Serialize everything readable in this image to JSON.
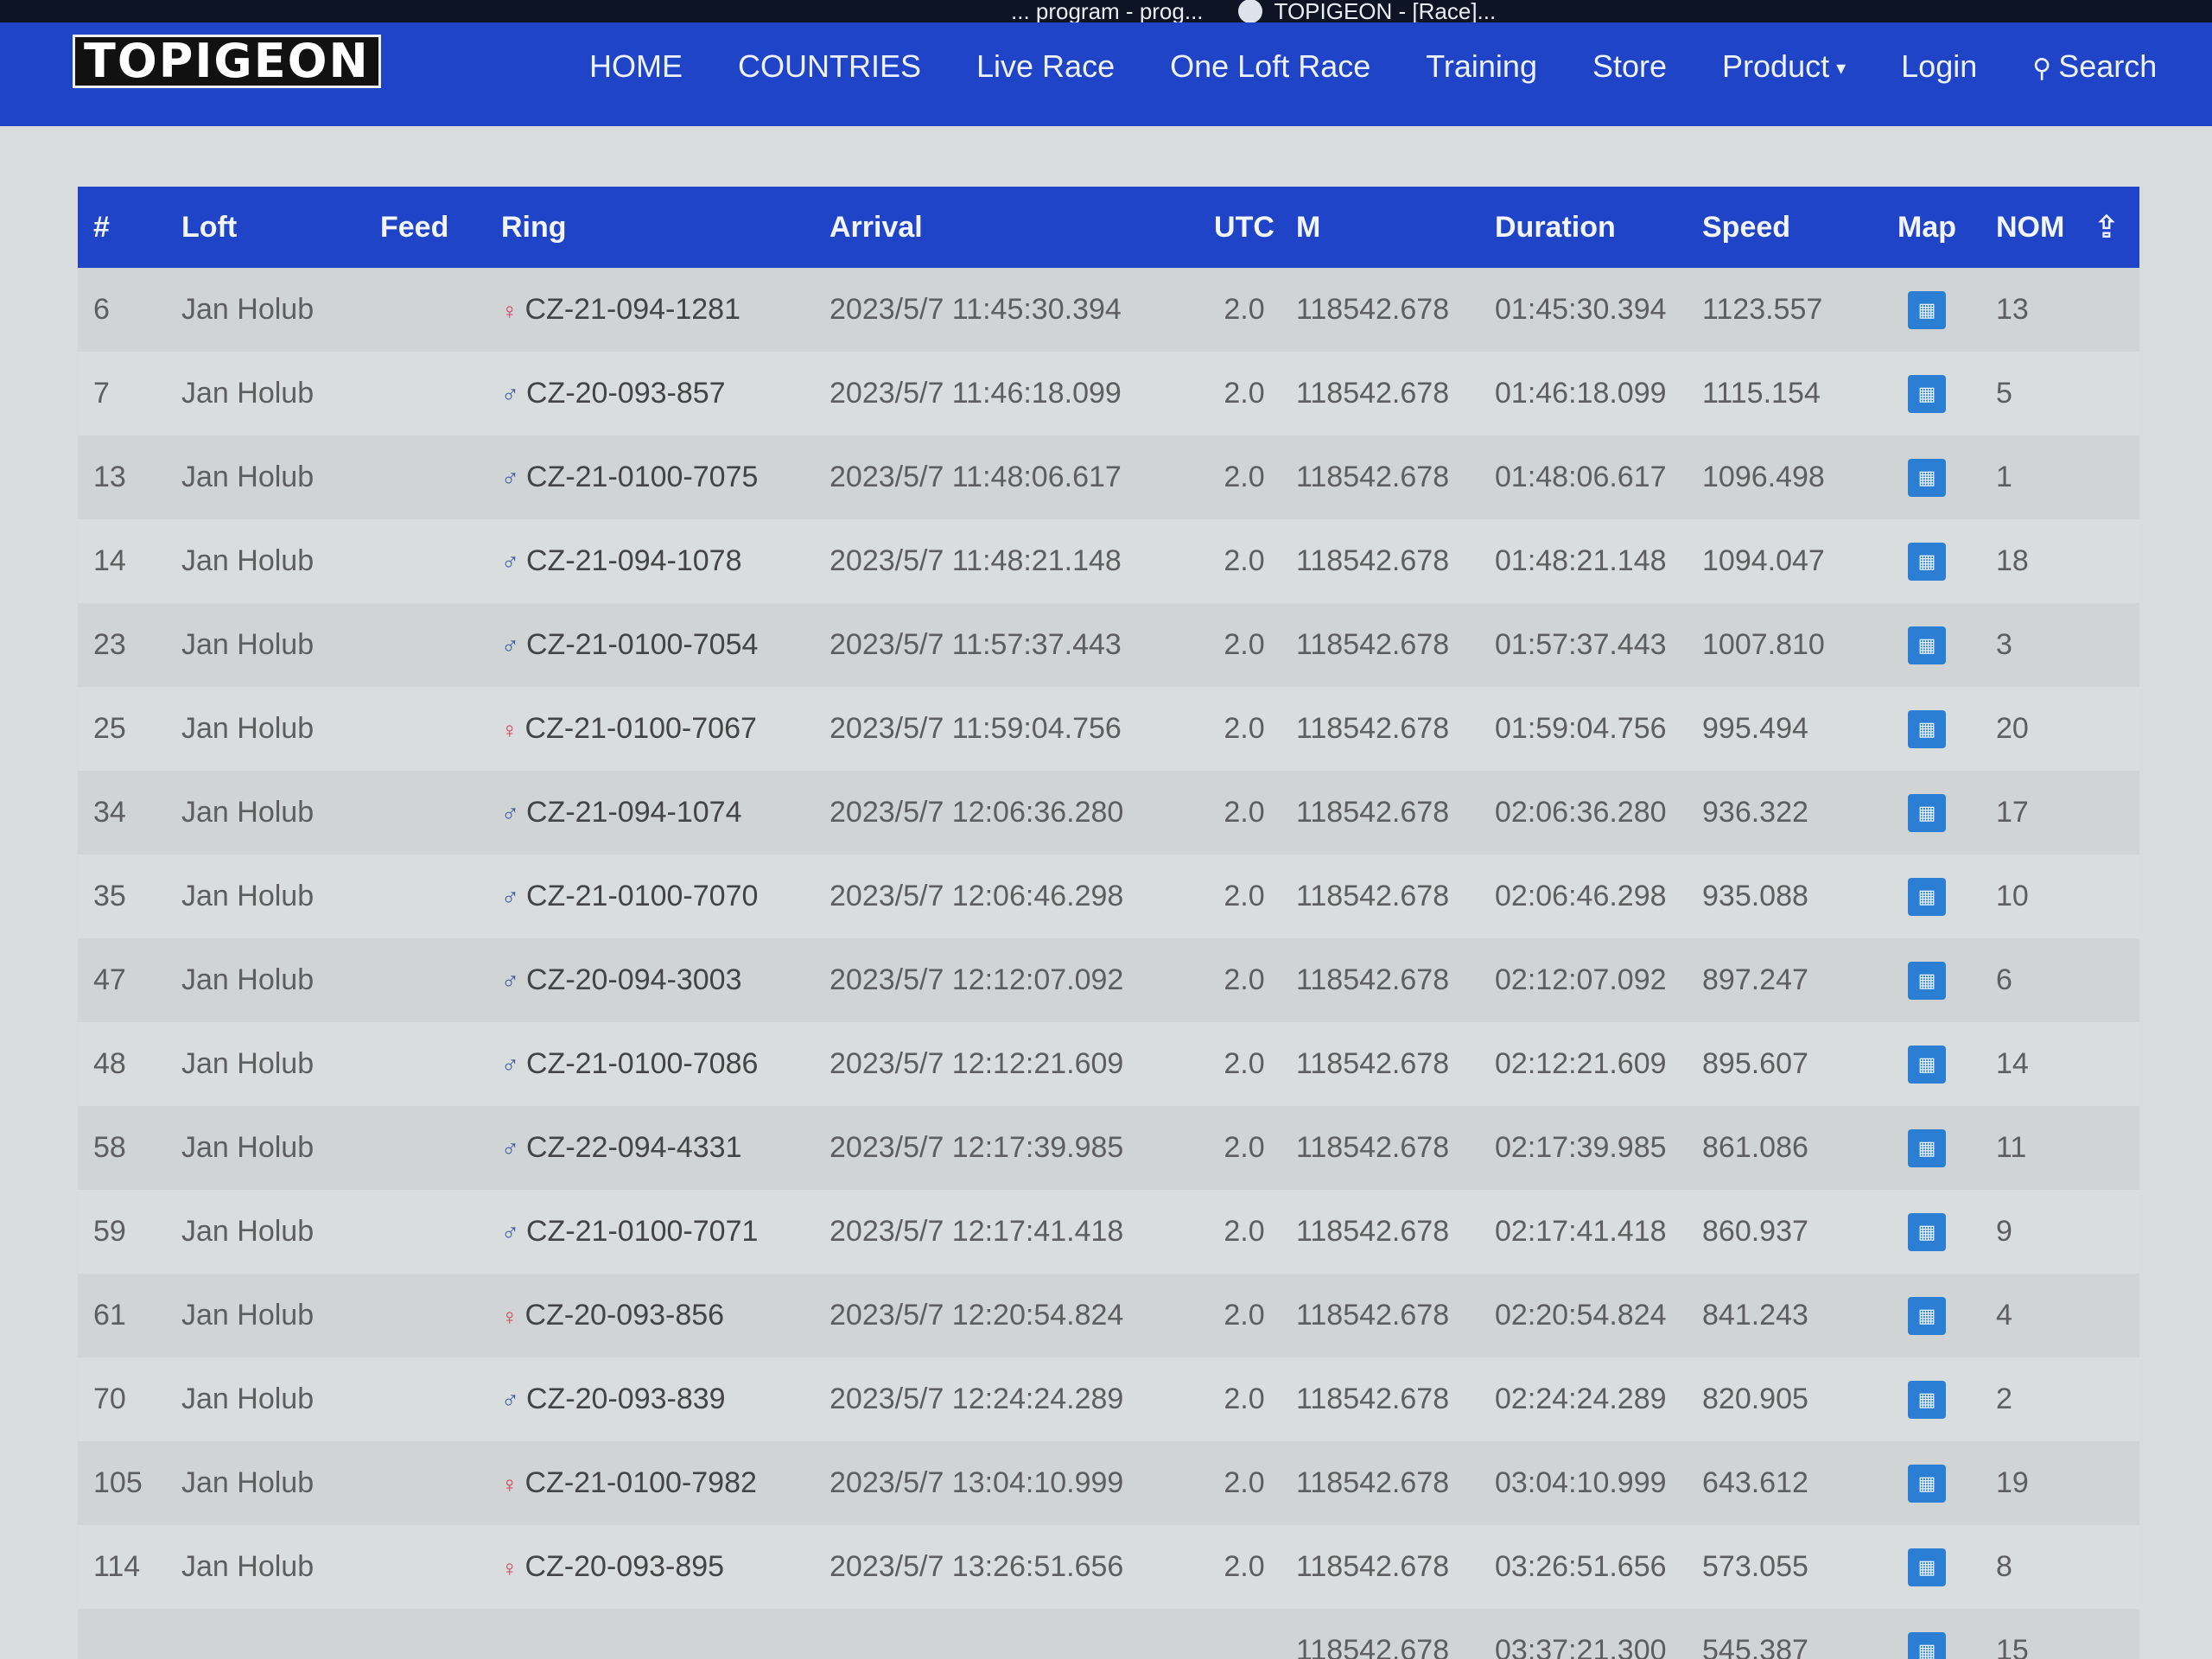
{
  "os_bar": {
    "tab1": "... program - prog...",
    "tab2": "TOPIGEON - [Race]..."
  },
  "brand": {
    "logo_text": "TOPIGEON"
  },
  "nav": {
    "items": [
      {
        "label": "HOME"
      },
      {
        "label": "COUNTRIES"
      },
      {
        "label": "Live Race"
      },
      {
        "label": "One Loft Race"
      },
      {
        "label": "Training"
      },
      {
        "label": "Store"
      },
      {
        "label": "Product"
      },
      {
        "label": "Login"
      },
      {
        "label": "Search"
      }
    ]
  },
  "table": {
    "headers": {
      "num": "#",
      "loft": "Loft",
      "feed": "Feed",
      "ring": "Ring",
      "arrival": "Arrival",
      "utc": "UTC",
      "m": "M",
      "duration": "Duration",
      "speed": "Speed",
      "map": "Map",
      "nom": "NOM"
    },
    "rows": [
      {
        "num": "6",
        "loft": "Jan Holub",
        "feed": "",
        "sex": "♀",
        "ring": "CZ-21-094-1281",
        "arrival": "2023/5/7 11:45:30.394",
        "utc": "2.0",
        "m": "118542.678",
        "duration": "01:45:30.394",
        "speed": "1123.557",
        "nom": "13"
      },
      {
        "num": "7",
        "loft": "Jan Holub",
        "feed": "",
        "sex": "♂",
        "ring": "CZ-20-093-857",
        "arrival": "2023/5/7 11:46:18.099",
        "utc": "2.0",
        "m": "118542.678",
        "duration": "01:46:18.099",
        "speed": "1115.154",
        "nom": "5"
      },
      {
        "num": "13",
        "loft": "Jan Holub",
        "feed": "",
        "sex": "♂",
        "ring": "CZ-21-0100-7075",
        "arrival": "2023/5/7 11:48:06.617",
        "utc": "2.0",
        "m": "118542.678",
        "duration": "01:48:06.617",
        "speed": "1096.498",
        "nom": "1"
      },
      {
        "num": "14",
        "loft": "Jan Holub",
        "feed": "",
        "sex": "♂",
        "ring": "CZ-21-094-1078",
        "arrival": "2023/5/7 11:48:21.148",
        "utc": "2.0",
        "m": "118542.678",
        "duration": "01:48:21.148",
        "speed": "1094.047",
        "nom": "18"
      },
      {
        "num": "23",
        "loft": "Jan Holub",
        "feed": "",
        "sex": "♂",
        "ring": "CZ-21-0100-7054",
        "arrival": "2023/5/7 11:57:37.443",
        "utc": "2.0",
        "m": "118542.678",
        "duration": "01:57:37.443",
        "speed": "1007.810",
        "nom": "3"
      },
      {
        "num": "25",
        "loft": "Jan Holub",
        "feed": "",
        "sex": "♀",
        "ring": "CZ-21-0100-7067",
        "arrival": "2023/5/7 11:59:04.756",
        "utc": "2.0",
        "m": "118542.678",
        "duration": "01:59:04.756",
        "speed": "995.494",
        "nom": "20"
      },
      {
        "num": "34",
        "loft": "Jan Holub",
        "feed": "",
        "sex": "♂",
        "ring": "CZ-21-094-1074",
        "arrival": "2023/5/7 12:06:36.280",
        "utc": "2.0",
        "m": "118542.678",
        "duration": "02:06:36.280",
        "speed": "936.322",
        "nom": "17"
      },
      {
        "num": "35",
        "loft": "Jan Holub",
        "feed": "",
        "sex": "♂",
        "ring": "CZ-21-0100-7070",
        "arrival": "2023/5/7 12:06:46.298",
        "utc": "2.0",
        "m": "118542.678",
        "duration": "02:06:46.298",
        "speed": "935.088",
        "nom": "10"
      },
      {
        "num": "47",
        "loft": "Jan Holub",
        "feed": "",
        "sex": "♂",
        "ring": "CZ-20-094-3003",
        "arrival": "2023/5/7 12:12:07.092",
        "utc": "2.0",
        "m": "118542.678",
        "duration": "02:12:07.092",
        "speed": "897.247",
        "nom": "6"
      },
      {
        "num": "48",
        "loft": "Jan Holub",
        "feed": "",
        "sex": "♂",
        "ring": "CZ-21-0100-7086",
        "arrival": "2023/5/7 12:12:21.609",
        "utc": "2.0",
        "m": "118542.678",
        "duration": "02:12:21.609",
        "speed": "895.607",
        "nom": "14"
      },
      {
        "num": "58",
        "loft": "Jan Holub",
        "feed": "",
        "sex": "♂",
        "ring": "CZ-22-094-4331",
        "arrival": "2023/5/7 12:17:39.985",
        "utc": "2.0",
        "m": "118542.678",
        "duration": "02:17:39.985",
        "speed": "861.086",
        "nom": "11"
      },
      {
        "num": "59",
        "loft": "Jan Holub",
        "feed": "",
        "sex": "♂",
        "ring": "CZ-21-0100-7071",
        "arrival": "2023/5/7 12:17:41.418",
        "utc": "2.0",
        "m": "118542.678",
        "duration": "02:17:41.418",
        "speed": "860.937",
        "nom": "9"
      },
      {
        "num": "61",
        "loft": "Jan Holub",
        "feed": "",
        "sex": "♀",
        "ring": "CZ-20-093-856",
        "arrival": "2023/5/7 12:20:54.824",
        "utc": "2.0",
        "m": "118542.678",
        "duration": "02:20:54.824",
        "speed": "841.243",
        "nom": "4"
      },
      {
        "num": "70",
        "loft": "Jan Holub",
        "feed": "",
        "sex": "♂",
        "ring": "CZ-20-093-839",
        "arrival": "2023/5/7 12:24:24.289",
        "utc": "2.0",
        "m": "118542.678",
        "duration": "02:24:24.289",
        "speed": "820.905",
        "nom": "2"
      },
      {
        "num": "105",
        "loft": "Jan Holub",
        "feed": "",
        "sex": "♀",
        "ring": "CZ-21-0100-7982",
        "arrival": "2023/5/7 13:04:10.999",
        "utc": "2.0",
        "m": "118542.678",
        "duration": "03:04:10.999",
        "speed": "643.612",
        "nom": "19"
      },
      {
        "num": "114",
        "loft": "Jan Holub",
        "feed": "",
        "sex": "♀",
        "ring": "CZ-20-093-895",
        "arrival": "2023/5/7 13:26:51.656",
        "utc": "2.0",
        "m": "118542.678",
        "duration": "03:26:51.656",
        "speed": "573.055",
        "nom": "8"
      },
      {
        "num": "",
        "loft": "",
        "feed": "",
        "sex": "",
        "ring": "",
        "arrival": "",
        "utc": "",
        "m": "118542.678",
        "duration": "03:37:21.300",
        "speed": "545.387",
        "nom": "15"
      }
    ]
  },
  "colors": {
    "navbar": "#1f44c8",
    "header": "#1f44c8",
    "map_button": "#2a7fd4",
    "female_symbol": "#d23a54",
    "male_symbol": "#3d5aa0"
  },
  "icons": {
    "map": "map-icon",
    "share": "share-icon",
    "search": "search-icon",
    "caret": "caret-down-icon"
  }
}
